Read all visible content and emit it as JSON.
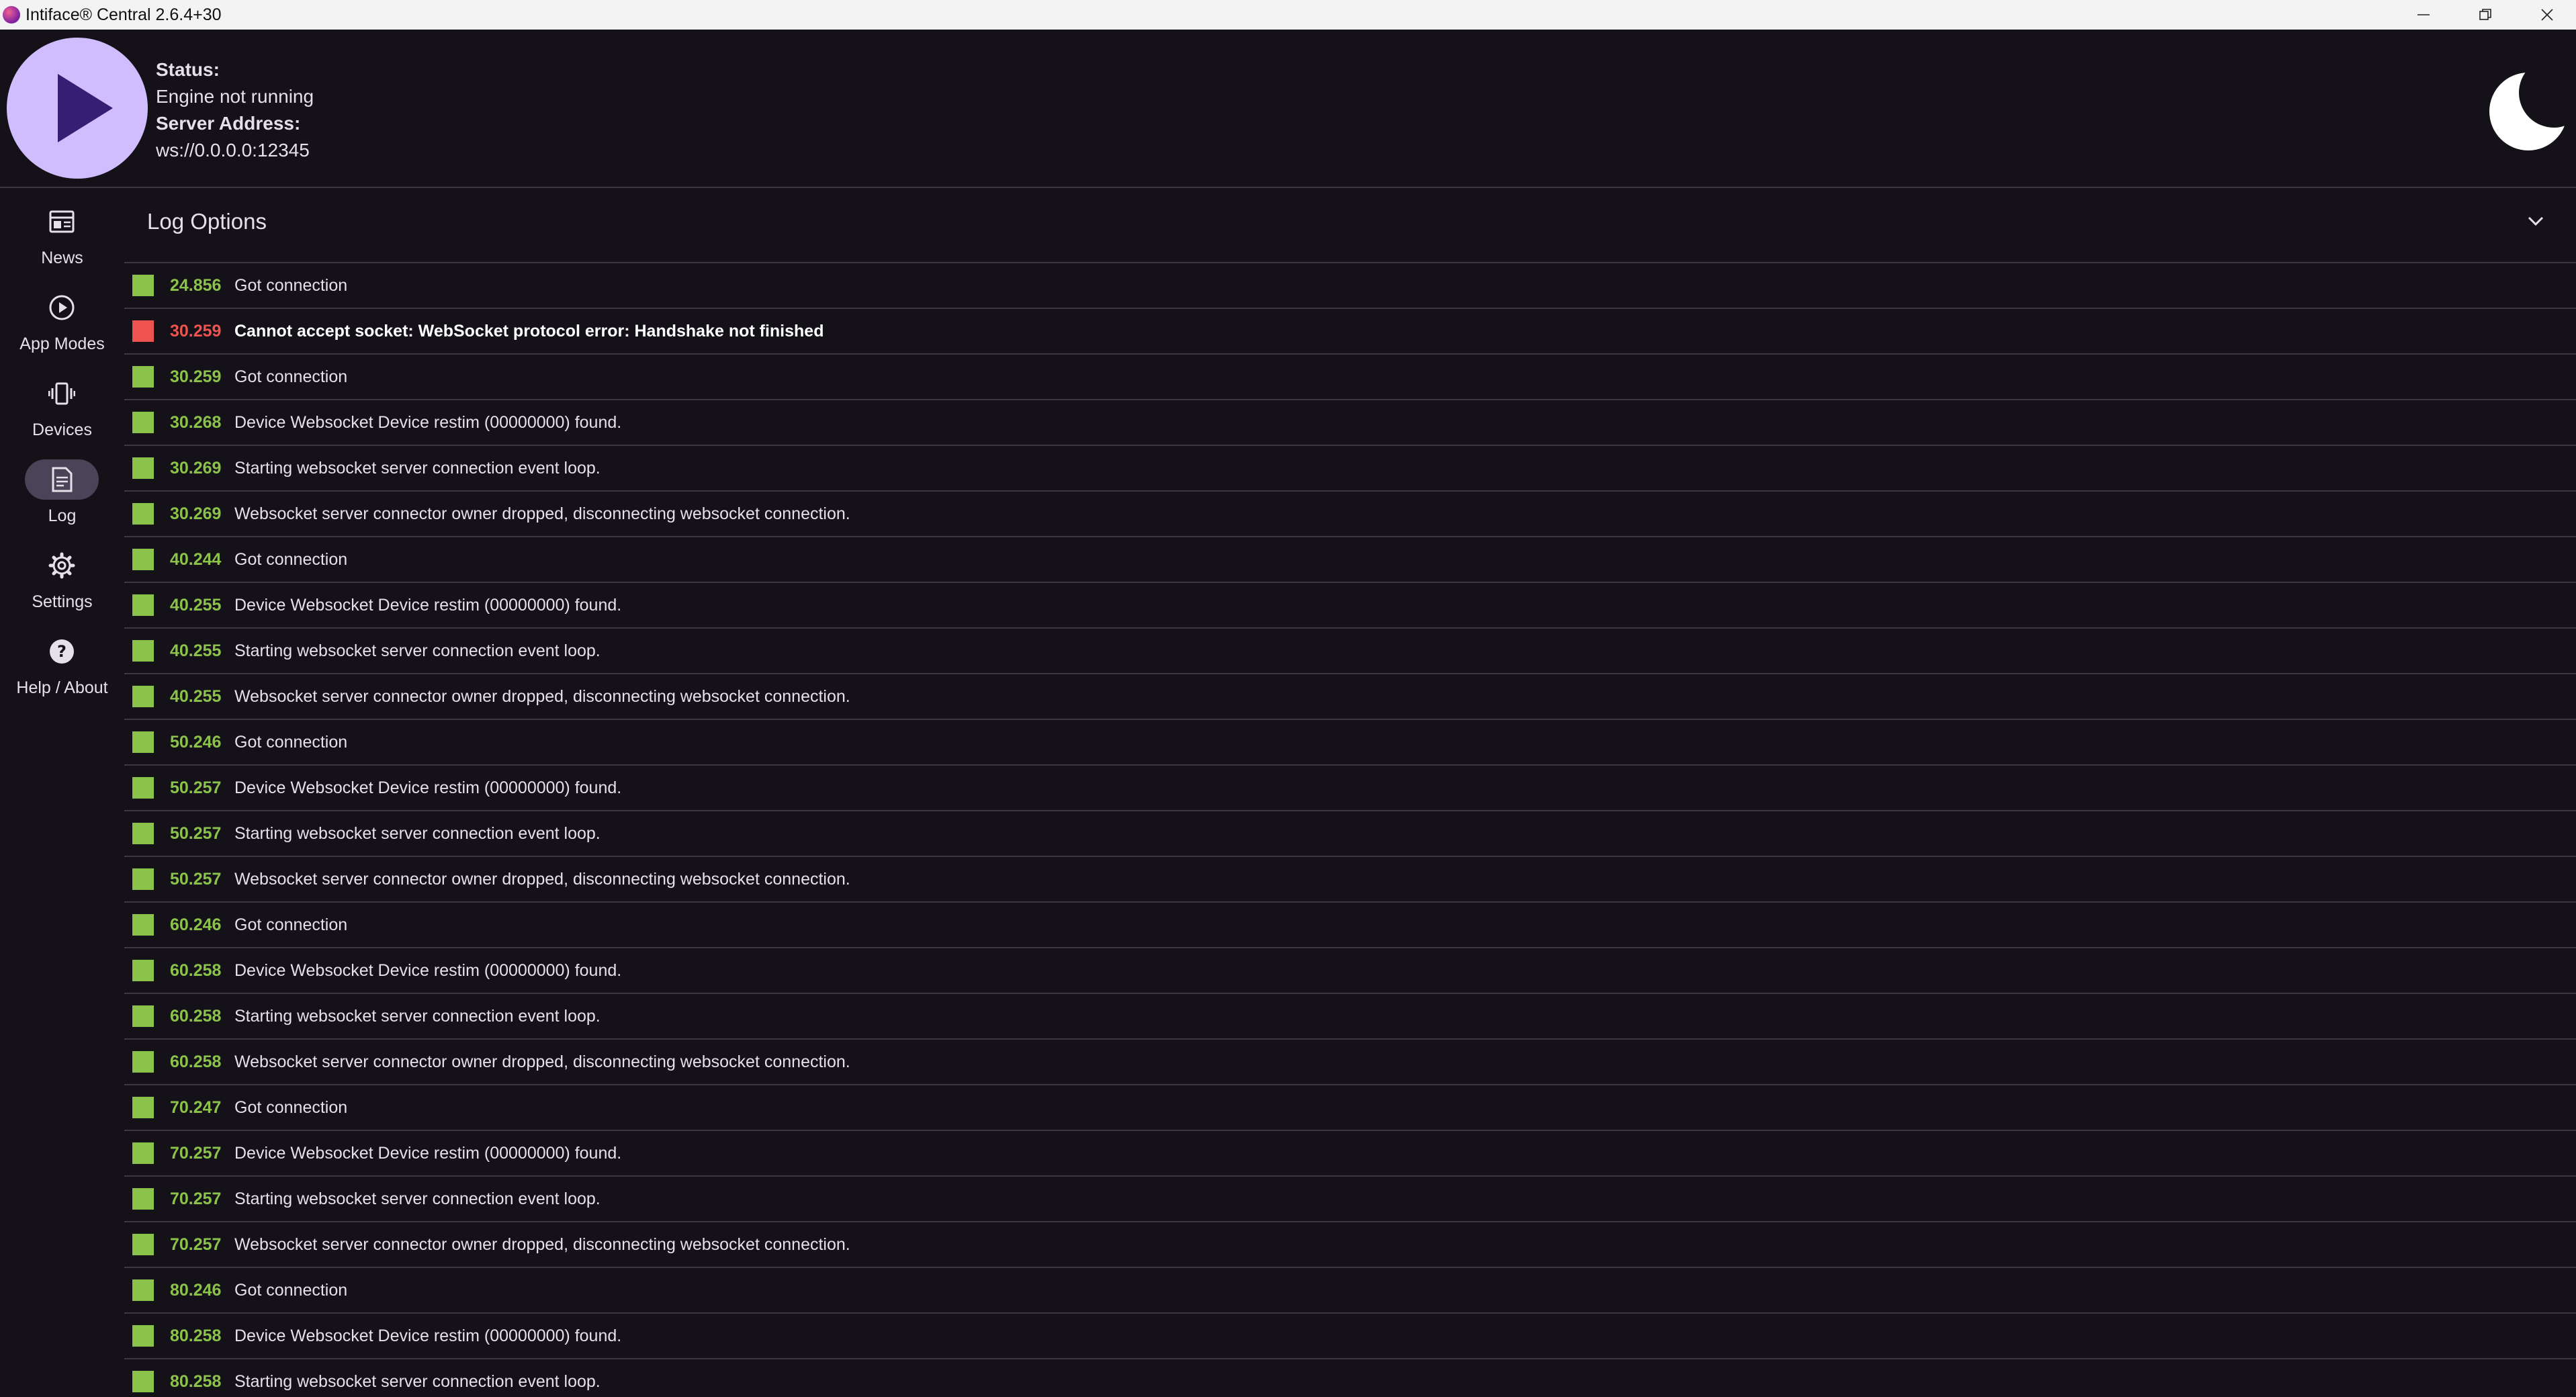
{
  "window": {
    "title": "Intiface® Central 2.6.4+30",
    "buttons": {
      "minimize": "minimize-icon",
      "maximize": "restore-icon",
      "close": "close-icon"
    }
  },
  "header": {
    "status_label": "Status:",
    "status_value": "Engine not running",
    "address_label": "Server Address:",
    "address_value": "ws://0.0.0.0:12345",
    "play_icon": "play-icon",
    "theme_icon": "moon-icon",
    "accent_color": "#cfbdfe",
    "play_icon_color": "#381e72"
  },
  "sidebar": {
    "active": "Log",
    "items": [
      {
        "label": "News",
        "icon": "news-icon"
      },
      {
        "label": "App Modes",
        "icon": "play-circle-icon"
      },
      {
        "label": "Devices",
        "icon": "vibrate-icon"
      },
      {
        "label": "Log",
        "icon": "document-icon"
      },
      {
        "label": "Settings",
        "icon": "gear-icon"
      },
      {
        "label": "Help / About",
        "icon": "help-icon"
      }
    ]
  },
  "log_options": {
    "title": "Log Options",
    "icon": "chevron-down-icon"
  },
  "colors": {
    "info": "#8bc34a",
    "error": "#ef5350",
    "background": "#141218",
    "divider": "#3a3740"
  },
  "log_entries": [
    {
      "time": "24.856",
      "message": "Got connection",
      "level": "info"
    },
    {
      "time": "30.259",
      "message": "Cannot accept socket: WebSocket protocol error: Handshake not finished",
      "level": "error"
    },
    {
      "time": "30.259",
      "message": "Got connection",
      "level": "info"
    },
    {
      "time": "30.268",
      "message": "Device Websocket Device restim (00000000) found.",
      "level": "info"
    },
    {
      "time": "30.269",
      "message": "Starting websocket server connection event loop.",
      "level": "info"
    },
    {
      "time": "30.269",
      "message": "Websocket server connector owner dropped, disconnecting websocket connection.",
      "level": "info"
    },
    {
      "time": "40.244",
      "message": "Got connection",
      "level": "info"
    },
    {
      "time": "40.255",
      "message": "Device Websocket Device restim (00000000) found.",
      "level": "info"
    },
    {
      "time": "40.255",
      "message": "Starting websocket server connection event loop.",
      "level": "info"
    },
    {
      "time": "40.255",
      "message": "Websocket server connector owner dropped, disconnecting websocket connection.",
      "level": "info"
    },
    {
      "time": "50.246",
      "message": "Got connection",
      "level": "info"
    },
    {
      "time": "50.257",
      "message": "Device Websocket Device restim (00000000) found.",
      "level": "info"
    },
    {
      "time": "50.257",
      "message": "Starting websocket server connection event loop.",
      "level": "info"
    },
    {
      "time": "50.257",
      "message": "Websocket server connector owner dropped, disconnecting websocket connection.",
      "level": "info"
    },
    {
      "time": "60.246",
      "message": "Got connection",
      "level": "info"
    },
    {
      "time": "60.258",
      "message": "Device Websocket Device restim (00000000) found.",
      "level": "info"
    },
    {
      "time": "60.258",
      "message": "Starting websocket server connection event loop.",
      "level": "info"
    },
    {
      "time": "60.258",
      "message": "Websocket server connector owner dropped, disconnecting websocket connection.",
      "level": "info"
    },
    {
      "time": "70.247",
      "message": "Got connection",
      "level": "info"
    },
    {
      "time": "70.257",
      "message": "Device Websocket Device restim (00000000) found.",
      "level": "info"
    },
    {
      "time": "70.257",
      "message": "Starting websocket server connection event loop.",
      "level": "info"
    },
    {
      "time": "70.257",
      "message": "Websocket server connector owner dropped, disconnecting websocket connection.",
      "level": "info"
    },
    {
      "time": "80.246",
      "message": "Got connection",
      "level": "info"
    },
    {
      "time": "80.258",
      "message": "Device Websocket Device restim (00000000) found.",
      "level": "info"
    },
    {
      "time": "80.258",
      "message": "Starting websocket server connection event loop.",
      "level": "info"
    }
  ]
}
